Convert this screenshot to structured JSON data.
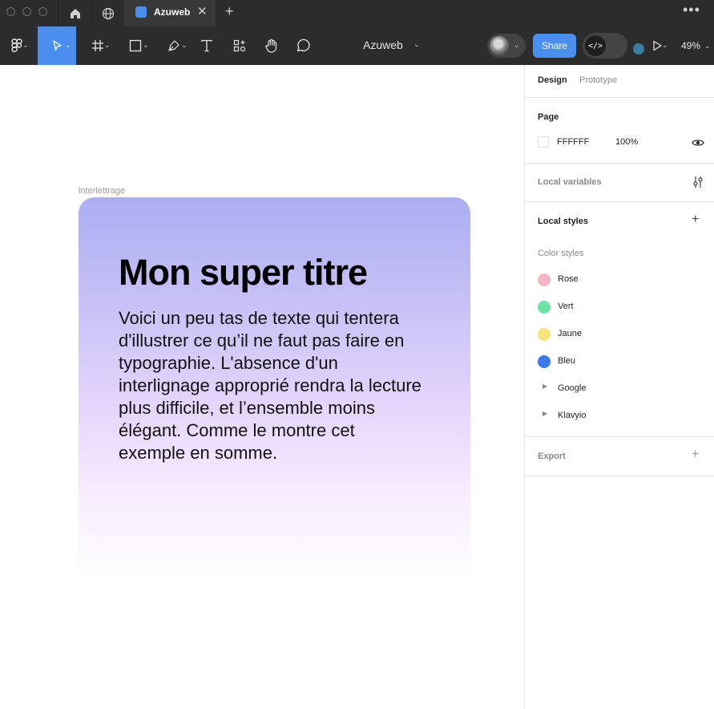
{
  "tabbar": {
    "tab_title": "Azuweb",
    "new_tab": "+",
    "more": "•••"
  },
  "toolbar": {
    "file_name": "Azuweb",
    "share_label": "Share",
    "dev_mode_icon": "</>",
    "zoom": "49%"
  },
  "canvas": {
    "frame_label": "interlettrage",
    "title": "Mon super titre",
    "body": "Voici un peu tas de texte qui tentera d'illustrer ce qu’il ne faut pas faire en typographie. L'absence d'un interlignage approprié rendra la lecture plus difficile, et l’ensemble moins élégant. Comme le montre cet exemple en somme."
  },
  "panel": {
    "tabs": [
      "Design",
      "Prototype"
    ],
    "page_heading": "Page",
    "page_color": "FFFFFF",
    "page_opacity": "100%",
    "local_variables": "Local variables",
    "local_styles": "Local styles",
    "color_styles_heading": "Color styles",
    "color_styles": [
      {
        "name": "Rose",
        "color": "#f4b6c0"
      },
      {
        "name": "Vert",
        "color": "#6ee3a3"
      },
      {
        "name": "Jaune",
        "color": "#f8e27a"
      },
      {
        "name": "Bleu",
        "color": "#3a7be8"
      }
    ],
    "groups": [
      "Google",
      "Klavyio"
    ],
    "export": "Export"
  },
  "colors": {
    "accent": "#4a8ef0",
    "toolbar_bg": "#2c2c2c"
  }
}
